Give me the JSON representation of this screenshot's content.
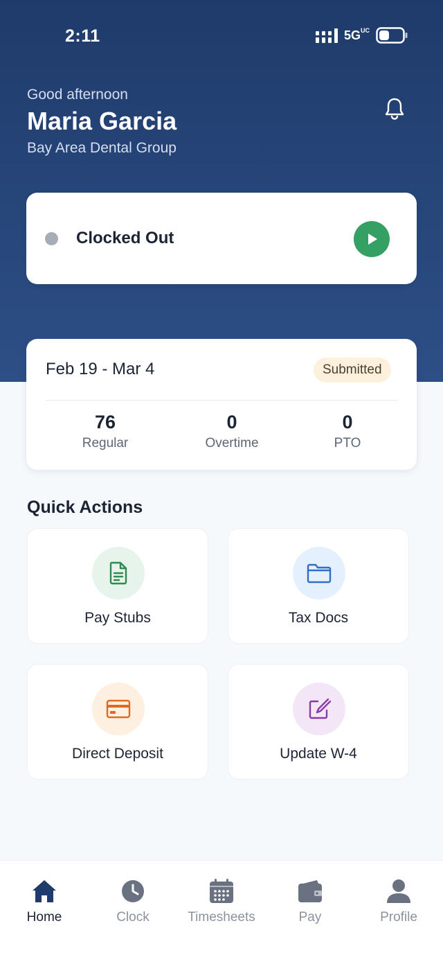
{
  "status_bar": {
    "time": "2:11",
    "network": "5G",
    "network_suffix": "UC"
  },
  "header": {
    "greeting": "Good afternoon",
    "user_name": "Maria Garcia",
    "company": "Bay Area Dental Group"
  },
  "clock_card": {
    "status": "Clocked Out",
    "status_color": "#a6adb8",
    "action_color": "#35a064"
  },
  "pay_period": {
    "range": "Feb 19 - Mar 4",
    "status": "Submitted",
    "stats": [
      {
        "value": "76",
        "label": "Regular"
      },
      {
        "value": "0",
        "label": "Overtime"
      },
      {
        "value": "0",
        "label": "PTO"
      }
    ]
  },
  "quick_actions": {
    "heading": "Quick Actions",
    "items": [
      {
        "label": "Pay Stubs",
        "icon": "document-icon",
        "bg": "#e7f4ec",
        "color": "#2e8a4f"
      },
      {
        "label": "Tax Docs",
        "icon": "folder-icon",
        "bg": "#e4f0fd",
        "color": "#2e6fc4"
      },
      {
        "label": "Direct Deposit",
        "icon": "credit-card-icon",
        "bg": "#fdf0e0",
        "color": "#e06a1c"
      },
      {
        "label": "Update W-4",
        "icon": "edit-icon",
        "bg": "#f3e6f6",
        "color": "#8a3aa8"
      }
    ]
  },
  "nav": {
    "items": [
      {
        "label": "Home",
        "icon": "home-icon",
        "active": true
      },
      {
        "label": "Clock",
        "icon": "clock-icon",
        "active": false
      },
      {
        "label": "Timesheets",
        "icon": "calendar-icon",
        "active": false
      },
      {
        "label": "Pay",
        "icon": "wallet-icon",
        "active": false
      },
      {
        "label": "Profile",
        "icon": "person-icon",
        "active": false
      }
    ],
    "active_color": "#1f3b6b",
    "inactive_color": "#6a7282"
  }
}
